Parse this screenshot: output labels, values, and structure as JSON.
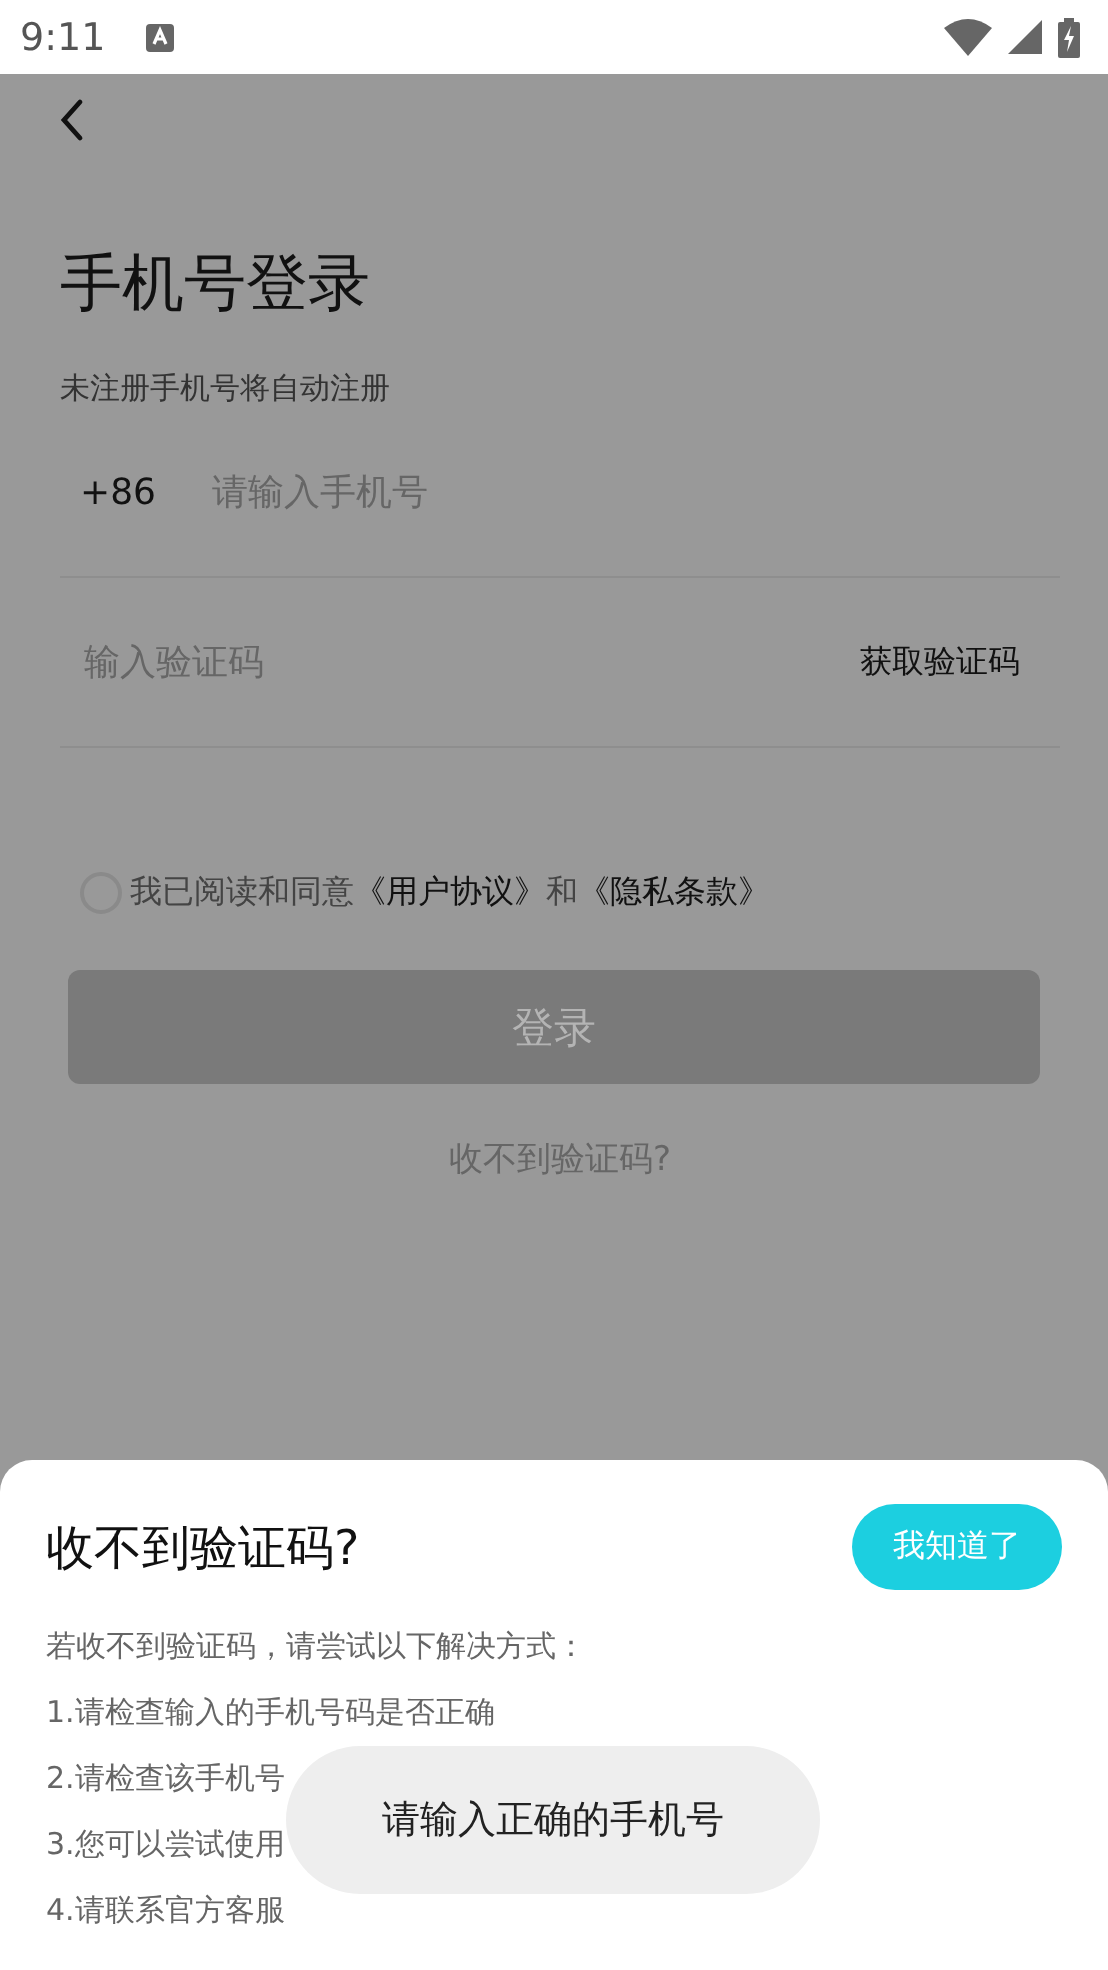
{
  "status_bar": {
    "time": "9:11"
  },
  "page": {
    "title": "手机号登录",
    "subtitle": "未注册手机号将自动注册",
    "phone": {
      "prefix": "+86",
      "placeholder": "请输入手机号"
    },
    "code": {
      "placeholder": "输入验证码",
      "action": "获取验证码"
    },
    "agreement": {
      "checked": false,
      "text": "我已阅读和同意",
      "link1": "《用户协议》",
      "joiner": "和",
      "link2": "《隐私条款》"
    },
    "login_button": {
      "label": "登录",
      "disabled": true
    },
    "help_link": "收不到验证码?"
  },
  "sheet": {
    "title": "收不到验证码?",
    "button": "我知道了",
    "intro": "若收不到验证码，请尝试以下解决方式：",
    "items": [
      "1.请检查输入的手机号码是否正确",
      "2.请检查该手机号",
      "3.您可以尝试使用",
      "4.请联系官方客服"
    ]
  },
  "toast": "请输入正确的手机号"
}
